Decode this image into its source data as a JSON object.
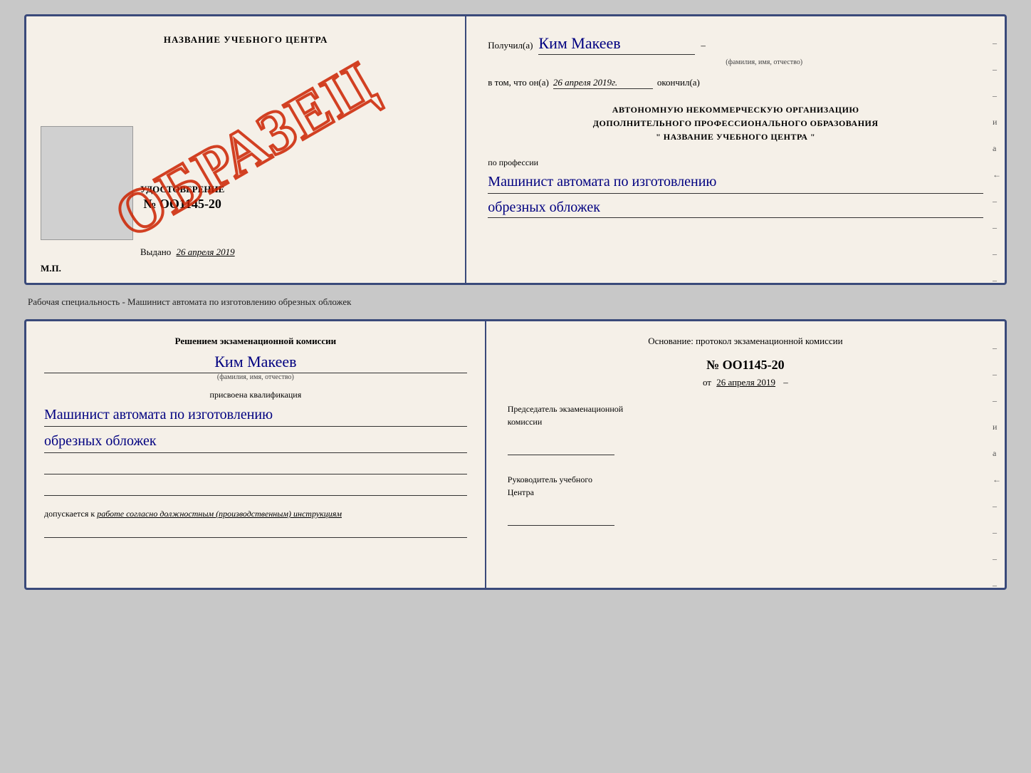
{
  "page": {
    "background_color": "#c8c8c8"
  },
  "top_certificate": {
    "left": {
      "title": "НАЗВАНИЕ УЧЕБНОГО ЦЕНТРА",
      "watermark": "ОБРАЗЕЦ",
      "udostoverenie_label": "УДОСТОВЕРЕНИЕ",
      "number": "№ OO1145-20",
      "vydano_label": "Выдано",
      "vydano_date": "26 апреля 2019",
      "mp_label": "М.П."
    },
    "right": {
      "poluchil_label": "Получил(а)",
      "recipient_name": "Ким Макеев",
      "fio_hint": "(фамилия, имя, отчество)",
      "v_tom_label": "в том, что он(а)",
      "date_value": "26 апреля 2019г.",
      "okonchil_label": "окончил(а)",
      "org_line1": "АВТОНОМНУЮ НЕКОММЕРЧЕСКУЮ ОРГАНИЗАЦИЮ",
      "org_line2": "ДОПОЛНИТЕЛЬНОГО ПРОФЕССИОНАЛЬНОГО ОБРАЗОВАНИЯ",
      "org_name": "\"  НАЗВАНИЕ УЧЕБНОГО ЦЕНТРА  \"",
      "po_professii_label": "по профессии",
      "profession_line1": "Машинист автомата по изготовлению",
      "profession_line2": "обрезных обложек"
    }
  },
  "divider_text": "Рабочая специальность - Машинист автомата по изготовлению обрезных обложек",
  "bottom_certificate": {
    "left": {
      "resheniem_label": "Решением экзаменационной комиссии",
      "recipient_name": "Ким Макеев",
      "fio_hint": "(фамилия, имя, отчество)",
      "prisvoena_label": "присвоена квалификация",
      "qualification_line1": "Машинист автомата по изготовлению",
      "qualification_line2": "обрезных обложек",
      "dopuskaetsya_prefix": "допускается к ",
      "dopuskaetsya_text": "работе согласно должностным (производственным) инструкциям"
    },
    "right": {
      "osnovanie_label": "Основание: протокол экзаменационной комиссии",
      "protocol_number": "№  OO1145-20",
      "ot_label": "от",
      "ot_date": "26 апреля 2019",
      "dash_after_date": "–",
      "chairman_line1": "Председатель экзаменационной",
      "chairman_line2": "комиссии",
      "rukovoditel_line1": "Руководитель учебного",
      "rukovoditel_line2": "Центра"
    }
  },
  "side_dashes": [
    "–",
    "–",
    "–",
    "и",
    "а",
    "←",
    "–",
    "–",
    "–",
    "–"
  ]
}
